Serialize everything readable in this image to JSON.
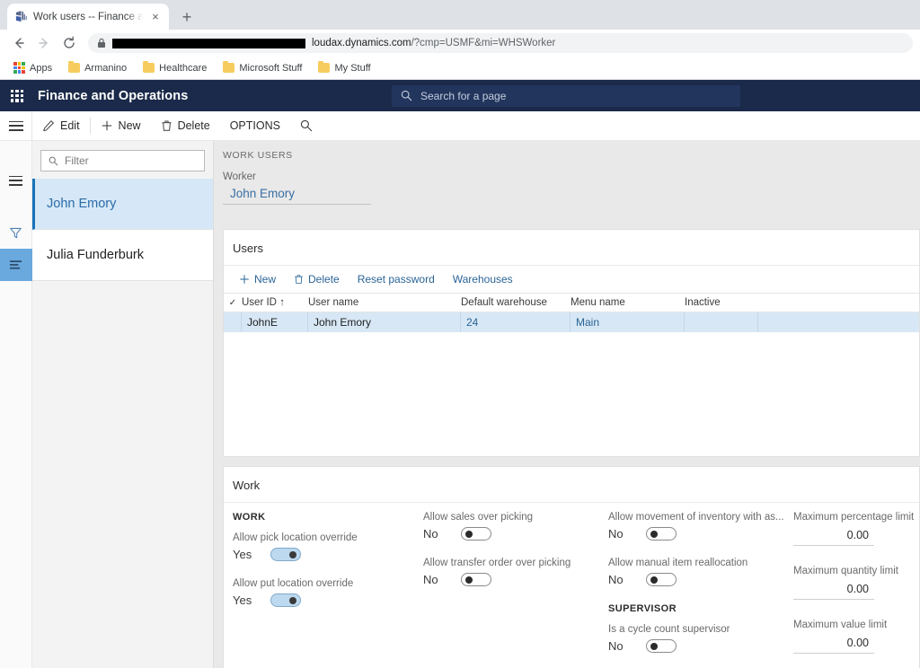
{
  "browser": {
    "tab": {
      "title": "Work users -- Finance and Opera",
      "favicon": "dynamics-favicon",
      "close_label": "×"
    },
    "new_tab_label": "+",
    "nav": {
      "back": "←",
      "forward": "→",
      "reload": "⟳"
    },
    "omnibox": {
      "lock": "\u0001",
      "redacted": true,
      "url_visible": "loudax.dynamics.com",
      "url_query": "/?cmp=USMF&mi=WHSWorker"
    },
    "bookmarks": [
      {
        "label": "Apps",
        "icon": "apps-grid-icon"
      },
      {
        "label": "Armanino",
        "icon": "folder-icon"
      },
      {
        "label": "Healthcare",
        "icon": "folder-icon"
      },
      {
        "label": "Microsoft Stuff",
        "icon": "folder-icon"
      },
      {
        "label": "My Stuff",
        "icon": "folder-icon"
      }
    ]
  },
  "app": {
    "title": "Finance and Operations",
    "waffle_icon": "app-launcher-icon",
    "search": {
      "placeholder": "Search for a page",
      "icon": "search-icon"
    },
    "action_bar": {
      "menu_icon": "hamburger-icon",
      "buttons": [
        {
          "label": "Edit",
          "icon": "pencil-icon"
        },
        {
          "label": "New",
          "icon": "plus-icon"
        },
        {
          "label": "Delete",
          "icon": "trash-icon"
        },
        {
          "label": "OPTIONS",
          "icon": ""
        }
      ],
      "search_icon": "search-icon"
    }
  },
  "rail": {
    "items": [
      {
        "name": "hamburger-icon",
        "active": false
      },
      {
        "name": "filter-icon",
        "active": false
      },
      {
        "name": "list-icon",
        "active": true
      }
    ]
  },
  "list_pane": {
    "filter": {
      "placeholder": "Filter",
      "value": "",
      "icon": "search-icon"
    },
    "items": [
      {
        "label": "John Emory",
        "selected": true
      },
      {
        "label": "Julia Funderburk",
        "selected": false
      }
    ]
  },
  "page": {
    "caption": "WORK USERS",
    "worker_label": "Worker",
    "worker_value": "John Emory"
  },
  "users_card": {
    "title": "Users",
    "toolbar": [
      {
        "label": "New",
        "icon": "plus-icon"
      },
      {
        "label": "Delete",
        "icon": "trash-icon"
      },
      {
        "label": "Reset password",
        "icon": ""
      },
      {
        "label": "Warehouses",
        "icon": ""
      }
    ],
    "columns": [
      {
        "label": "User ID",
        "sort": "↑"
      },
      {
        "label": "User name",
        "sort": ""
      },
      {
        "label": "Default warehouse",
        "sort": ""
      },
      {
        "label": "Menu name",
        "sort": ""
      },
      {
        "label": "Inactive",
        "sort": ""
      }
    ],
    "check_icon": "✓",
    "rows": [
      {
        "user_id": "JohnE",
        "user_name": "John Emory",
        "default_warehouse": "24",
        "menu_name": "Main",
        "inactive": "",
        "selected": true
      }
    ]
  },
  "work_card": {
    "title": "Work",
    "col1": {
      "section": "WORK",
      "fields": [
        {
          "label": "Allow pick location override",
          "value": "Yes",
          "on": true
        },
        {
          "label": "Allow put location override",
          "value": "Yes",
          "on": true
        }
      ]
    },
    "col2": {
      "fields": [
        {
          "label": "Allow sales over picking",
          "value": "No",
          "on": false
        },
        {
          "label": "Allow transfer order over picking",
          "value": "No",
          "on": false
        }
      ]
    },
    "col3": {
      "fields": [
        {
          "label": "Allow movement of inventory with as...",
          "value": "No",
          "on": false
        },
        {
          "label": "Allow manual item reallocation",
          "value": "No",
          "on": false
        }
      ],
      "section": "SUPERVISOR",
      "supervisor_fields": [
        {
          "label": "Is a cycle count supervisor",
          "value": "No",
          "on": false
        }
      ]
    },
    "col4": {
      "fields": [
        {
          "label": "Maximum percentage limit",
          "value": "0.00"
        },
        {
          "label": "Maximum quantity limit",
          "value": "0.00"
        },
        {
          "label": "Maximum value limit",
          "value": "0.00"
        }
      ]
    }
  },
  "colors": {
    "header_bg": "#1b2a4a",
    "accent_link": "#2a6496",
    "selection_bg": "#d6e8f7",
    "toggle_on": "#bcd9ef"
  }
}
